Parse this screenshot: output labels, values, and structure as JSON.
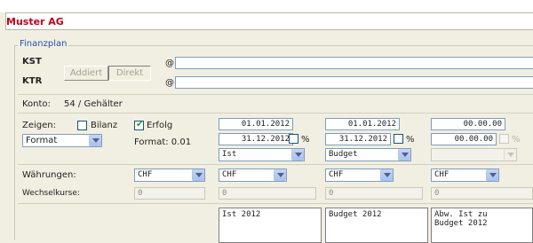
{
  "header": {
    "company": "Muster AG"
  },
  "section": {
    "legend": "Finanzplan"
  },
  "kst": {
    "label": "KST",
    "at": "@",
    "value": ""
  },
  "ktr": {
    "label": "KTR",
    "at": "@",
    "value": ""
  },
  "mode_buttons": {
    "addiert": "Addiert",
    "direkt": "Direkt"
  },
  "konto": {
    "label": "Konto:",
    "value": "54 / Gehälter"
  },
  "zeigen": {
    "label": "Zeigen:",
    "bilanz": {
      "label": "Bilanz",
      "checked": false
    },
    "erfolg": {
      "label": "Erfolg",
      "checked": true
    }
  },
  "format": {
    "select_value": "Format",
    "label": "Format: 0.01"
  },
  "columns": [
    {
      "date_from": "01.01.2012",
      "date_to": "31.12.2012",
      "percent": "%",
      "type": "Ist",
      "currency": "CHF",
      "rate": "0",
      "title": "Ist 2012"
    },
    {
      "date_from": "01.01.2012",
      "date_to": "31.12.2012",
      "percent": "%",
      "type": "Budget",
      "currency": "CHF",
      "rate": "0",
      "title": "Budget 2012"
    },
    {
      "date_from": "00.00.00",
      "date_to": "00.00.00",
      "percent": "%",
      "type": "",
      "currency": "CHF",
      "rate": "0",
      "title": "Abw. Ist zu\nBudget 2012"
    }
  ],
  "waehrungen": {
    "label": "Währungen:",
    "value": "CHF"
  },
  "wechselkurse": {
    "label": "Wechselkurse:",
    "value": "0"
  },
  "colors": {
    "company": "#c1001a",
    "legend": "#2a4fb3",
    "background": "#f1efe2"
  }
}
